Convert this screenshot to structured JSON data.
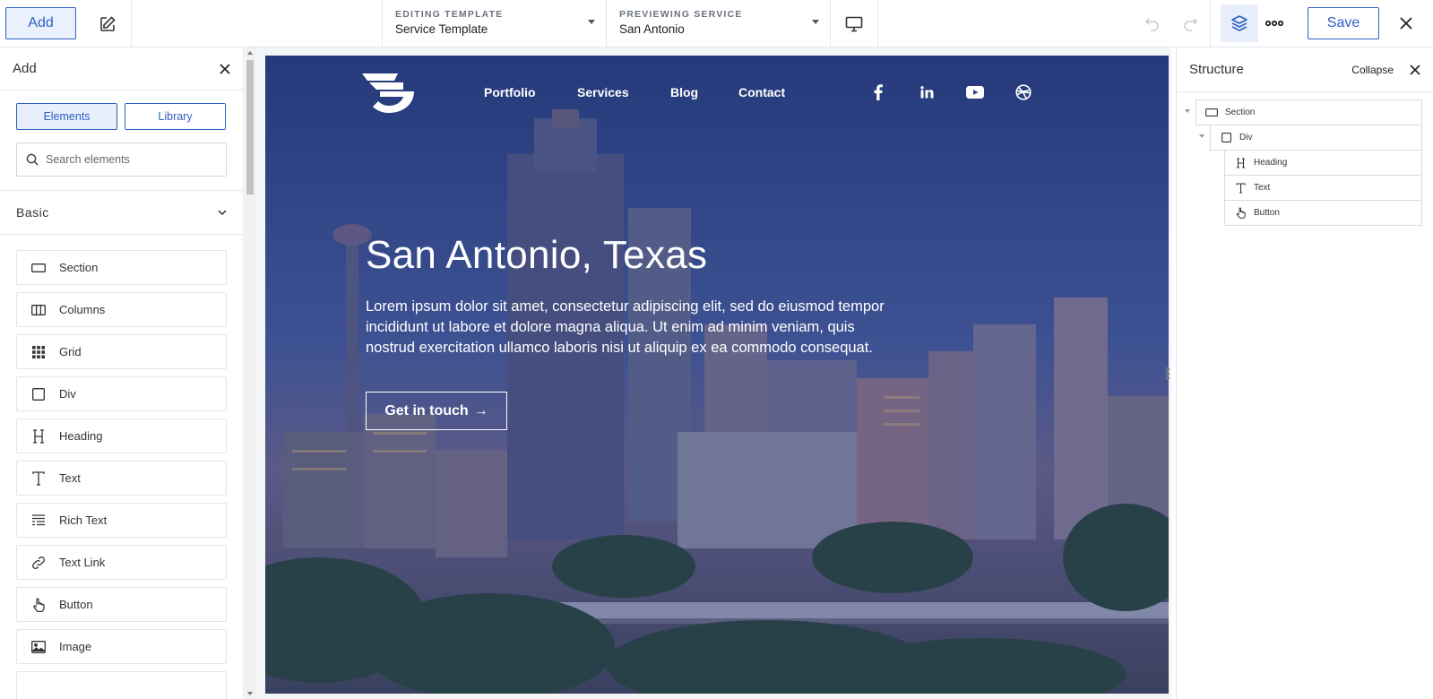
{
  "toolbar": {
    "add_label": "Add",
    "editing_caption": "EDITING TEMPLATE",
    "editing_value": "Service Template",
    "previewing_caption": "PREVIEWING SERVICE",
    "previewing_value": "San Antonio",
    "save_label": "Save"
  },
  "left_panel": {
    "title": "Add",
    "tab_elements": "Elements",
    "tab_library": "Library",
    "search_placeholder": "Search elements",
    "group_label": "Basic",
    "items": [
      {
        "label": "Section",
        "icon": "section-icon"
      },
      {
        "label": "Columns",
        "icon": "columns-icon"
      },
      {
        "label": "Grid",
        "icon": "grid-icon"
      },
      {
        "label": "Div",
        "icon": "div-icon"
      },
      {
        "label": "Heading",
        "icon": "heading-icon"
      },
      {
        "label": "Text",
        "icon": "text-icon"
      },
      {
        "label": "Rich Text",
        "icon": "rich-text-icon"
      },
      {
        "label": "Text Link",
        "icon": "link-icon"
      },
      {
        "label": "Button",
        "icon": "hand-pointer-icon"
      },
      {
        "label": "Image",
        "icon": "image-icon"
      }
    ]
  },
  "preview": {
    "nav": {
      "links": [
        "Portfolio",
        "Services",
        "Blog",
        "Contact"
      ],
      "social": [
        "facebook-icon",
        "linkedin-icon",
        "youtube-icon",
        "dribbble-icon"
      ]
    },
    "hero": {
      "title": "San Antonio, Texas",
      "text": "Lorem ipsum dolor sit amet, consectetur adipiscing elit, sed do eiusmod tempor incididunt ut labore et dolore magna aliqua. Ut enim ad minim veniam, quis nostrud exercitation ullamco laboris nisi ut aliquip ex ea commodo consequat.",
      "button_label": "Get in touch"
    }
  },
  "right_panel": {
    "title": "Structure",
    "collapse_label": "Collapse",
    "tree": [
      {
        "label": "Section",
        "icon": "section-icon"
      },
      {
        "label": "Div",
        "icon": "div-icon"
      },
      {
        "label": "Heading",
        "icon": "heading-icon"
      },
      {
        "label": "Text",
        "icon": "text-icon"
      },
      {
        "label": "Button",
        "icon": "hand-pointer-icon"
      }
    ]
  },
  "colors": {
    "accent": "#2f5ec4",
    "accent_bg": "#e8effb"
  }
}
